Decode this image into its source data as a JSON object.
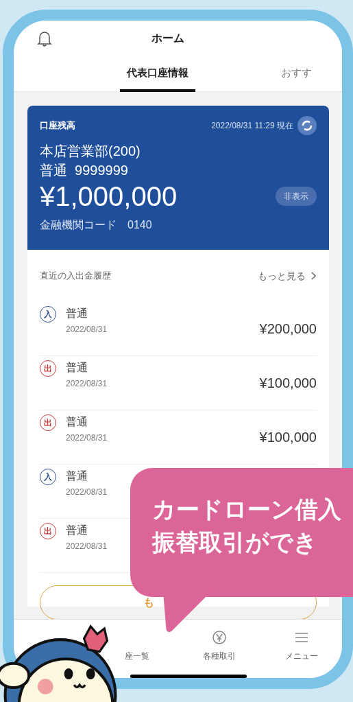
{
  "header": {
    "title": "ホーム"
  },
  "tabs": [
    {
      "label": "代表口座情報",
      "selected": true
    },
    {
      "label": "おすす",
      "selected": false
    }
  ],
  "balance_card": {
    "label": "口座残高",
    "timestamp": "2022/08/31 11:29 現在",
    "branch": "本店営業部(200)",
    "account": "普通  9999999",
    "balance": "¥1,000,000",
    "hide_button": "非表示",
    "institution_code": "金融機関コード　0140"
  },
  "history": {
    "title": "直近の入出金履歴",
    "more_link": "もっと見る",
    "rows": [
      {
        "kind": "in",
        "badge": "入",
        "name": "普通",
        "date": "2022/08/31",
        "amount": "¥200,000"
      },
      {
        "kind": "out",
        "badge": "出",
        "name": "普通",
        "date": "2022/08/31",
        "amount": "¥100,000"
      },
      {
        "kind": "out",
        "badge": "出",
        "name": "普通",
        "date": "2022/08/31",
        "amount": "¥100,000"
      },
      {
        "kind": "in",
        "badge": "入",
        "name": "普通",
        "date": "2022/08/31"
      },
      {
        "kind": "out",
        "badge": "出",
        "name": "普通",
        "date": "2022/08/31"
      }
    ],
    "more_button": "も"
  },
  "bottom_nav": [
    {
      "label": "座一覧"
    },
    {
      "label": "各種取引"
    },
    {
      "label": "メニュー"
    }
  ],
  "speech_bubble": {
    "lines": [
      "カードローン借入",
      "振替取引ができ"
    ]
  }
}
